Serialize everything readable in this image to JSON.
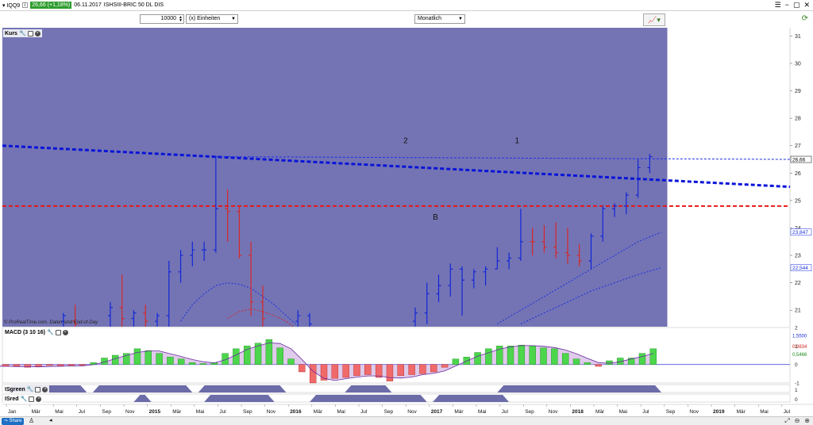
{
  "toolbar": {
    "symbol": "IQQ9",
    "info_icon": "i",
    "price_change": "26,66 (+1,18%)",
    "date": "06.11.2017",
    "instrument": "ISHSIII-BRIC 50 DL DIS",
    "quantity": "10000",
    "unit_select": "(x) Einheiten",
    "interval_select": "Monatlich",
    "window_icons": [
      "menu-icon",
      "minimize-icon",
      "restore-icon",
      "close-icon"
    ]
  },
  "panels": {
    "kurs": "Kurs",
    "macd": "MACD (3 10 16)",
    "isgreen": "ISgreen",
    "isred": "ISred"
  },
  "credit": "© ProRealTime.com. Daten sind End-of-Day",
  "share_label": "Share",
  "chart_data": {
    "type": "ohlc",
    "price_ylim": [
      20.4,
      31.3
    ],
    "price_ticks": [
      21,
      22,
      23,
      24,
      25,
      26,
      27,
      28,
      29,
      30,
      31
    ],
    "price_labels": {
      "last": "26,66",
      "upper_ma": "23,847",
      "lower_ma": "22,544"
    },
    "annotations": [
      {
        "text": "2",
        "month": 34,
        "price": 27.1
      },
      {
        "text": "1",
        "month": 43.5,
        "price": 27.1
      },
      {
        "text": "B",
        "month": 36.5,
        "price": 24.3
      }
    ],
    "candles": [
      {
        "m": 5,
        "o": 20.6,
        "h": 20.9,
        "l": 20.4,
        "c": 20.8,
        "dir": "up"
      },
      {
        "m": 6,
        "o": 20.6,
        "h": 21.2,
        "l": 20.4,
        "c": 20.5,
        "dir": "down"
      },
      {
        "m": 9,
        "o": 20.8,
        "h": 21.3,
        "l": 20.4,
        "c": 21.1,
        "dir": "up"
      },
      {
        "m": 10,
        "o": 21.1,
        "h": 22.3,
        "l": 20.4,
        "c": 20.7,
        "dir": "down"
      },
      {
        "m": 11,
        "o": 20.7,
        "h": 21.0,
        "l": 20.4,
        "c": 20.9,
        "dir": "up"
      },
      {
        "m": 12,
        "o": 20.9,
        "h": 21.2,
        "l": 20.4,
        "c": 20.6,
        "dir": "down"
      },
      {
        "m": 13,
        "o": 20.6,
        "h": 20.9,
        "l": 20.4,
        "c": 20.8,
        "dir": "up"
      },
      {
        "m": 14,
        "o": 20.8,
        "h": 22.8,
        "l": 20.4,
        "c": 22.4,
        "dir": "up"
      },
      {
        "m": 15,
        "o": 22.4,
        "h": 23.2,
        "l": 22.0,
        "c": 23.0,
        "dir": "up"
      },
      {
        "m": 16,
        "o": 23.0,
        "h": 23.5,
        "l": 22.6,
        "c": 23.2,
        "dir": "up"
      },
      {
        "m": 17,
        "o": 23.2,
        "h": 23.5,
        "l": 22.8,
        "c": 23.2,
        "dir": "up"
      },
      {
        "m": 18,
        "o": 23.2,
        "h": 26.6,
        "l": 23.1,
        "c": 24.7,
        "dir": "up"
      },
      {
        "m": 19,
        "o": 24.7,
        "h": 25.4,
        "l": 23.5,
        "c": 24.6,
        "dir": "down"
      },
      {
        "m": 20,
        "o": 24.6,
        "h": 24.8,
        "l": 22.9,
        "c": 23.0,
        "dir": "down"
      },
      {
        "m": 21,
        "o": 23.0,
        "h": 23.5,
        "l": 20.8,
        "c": 21.3,
        "dir": "down"
      },
      {
        "m": 22,
        "o": 21.3,
        "h": 21.9,
        "l": 20.4,
        "c": 20.7,
        "dir": "down"
      },
      {
        "m": 25,
        "o": 20.6,
        "h": 21.0,
        "l": 20.4,
        "c": 20.8,
        "dir": "up"
      },
      {
        "m": 26,
        "o": 20.8,
        "h": 20.9,
        "l": 20.4,
        "c": 20.5,
        "dir": "up"
      },
      {
        "m": 35,
        "o": 20.6,
        "h": 21.1,
        "l": 20.4,
        "c": 20.9,
        "dir": "up"
      },
      {
        "m": 36,
        "o": 20.9,
        "h": 22.0,
        "l": 20.5,
        "c": 21.6,
        "dir": "up"
      },
      {
        "m": 37,
        "o": 21.6,
        "h": 22.3,
        "l": 21.3,
        "c": 21.9,
        "dir": "up"
      },
      {
        "m": 38,
        "o": 21.9,
        "h": 22.7,
        "l": 21.5,
        "c": 22.5,
        "dir": "up"
      },
      {
        "m": 39,
        "o": 22.5,
        "h": 22.6,
        "l": 20.8,
        "c": 22.1,
        "dir": "up"
      },
      {
        "m": 40,
        "o": 22.1,
        "h": 22.5,
        "l": 21.8,
        "c": 22.4,
        "dir": "up"
      },
      {
        "m": 41,
        "o": 22.4,
        "h": 22.6,
        "l": 21.9,
        "c": 22.5,
        "dir": "up"
      },
      {
        "m": 42,
        "o": 22.5,
        "h": 23.3,
        "l": 22.5,
        "c": 22.8,
        "dir": "up"
      },
      {
        "m": 43,
        "o": 22.8,
        "h": 23.1,
        "l": 22.5,
        "c": 22.9,
        "dir": "up"
      },
      {
        "m": 44,
        "o": 22.9,
        "h": 24.7,
        "l": 22.8,
        "c": 23.5,
        "dir": "up"
      },
      {
        "m": 45,
        "o": 23.5,
        "h": 24.0,
        "l": 23.0,
        "c": 23.5,
        "dir": "down"
      },
      {
        "m": 46,
        "o": 23.5,
        "h": 24.1,
        "l": 23.1,
        "c": 23.3,
        "dir": "down"
      },
      {
        "m": 47,
        "o": 23.3,
        "h": 24.2,
        "l": 22.9,
        "c": 23.1,
        "dir": "down"
      },
      {
        "m": 48,
        "o": 23.1,
        "h": 24.0,
        "l": 22.7,
        "c": 23.0,
        "dir": "down"
      },
      {
        "m": 49,
        "o": 23.0,
        "h": 23.4,
        "l": 22.6,
        "c": 22.8,
        "dir": "down"
      },
      {
        "m": 50,
        "o": 22.8,
        "h": 23.8,
        "l": 22.5,
        "c": 23.7,
        "dir": "up"
      },
      {
        "m": 51,
        "o": 23.7,
        "h": 24.8,
        "l": 23.5,
        "c": 24.7,
        "dir": "up"
      },
      {
        "m": 52,
        "o": 24.7,
        "h": 24.9,
        "l": 24.4,
        "c": 24.8,
        "dir": "up"
      },
      {
        "m": 53,
        "o": 24.8,
        "h": 25.3,
        "l": 24.5,
        "c": 25.2,
        "dir": "up"
      },
      {
        "m": 54,
        "o": 25.2,
        "h": 26.5,
        "l": 25.1,
        "c": 26.2,
        "dir": "up"
      },
      {
        "m": 55,
        "o": 26.2,
        "h": 26.7,
        "l": 26.0,
        "c": 26.6,
        "dir": "up"
      }
    ],
    "macd_ylim": [
      -1,
      2
    ],
    "macd_ticks": [
      "2",
      "1",
      "0",
      "-1"
    ],
    "macd_labels": [
      "1,5500",
      "0,9834",
      "0,5466"
    ],
    "macd_hist": [
      -0.1,
      -0.1,
      -0.12,
      -0.15,
      -0.12,
      -0.05,
      -0.1,
      -0.08,
      -0.05,
      0.1,
      0.35,
      0.5,
      0.6,
      0.85,
      0.75,
      0.6,
      0.4,
      0.3,
      0.1,
      0.05,
      0.1,
      0.6,
      0.85,
      1.0,
      1.15,
      1.35,
      0.9,
      0.3,
      -0.4,
      -1.0,
      -0.85,
      -0.75,
      -0.7,
      -0.6,
      -0.55,
      -0.7,
      -0.9,
      -0.6,
      -0.55,
      -0.5,
      -0.4,
      -0.15,
      0.3,
      0.4,
      0.65,
      0.85,
      1.0,
      1.0,
      1.05,
      1.0,
      0.9,
      0.85,
      0.6,
      0.3,
      0.1,
      -0.1,
      0.2,
      0.35,
      0.35,
      0.6,
      0.85
    ],
    "macd_scale_labels": {
      "isgreen": "1",
      "isred": "0"
    },
    "x_labels": [
      "Jan",
      "Mär",
      "Mai",
      "Jul",
      "Sep",
      "Nov",
      "2015",
      "Mär",
      "Mai",
      "Jul",
      "Sep",
      "Nov",
      "2016",
      "Mär",
      "Mai",
      "Jul",
      "Sep",
      "Nov",
      "2017",
      "Mär",
      "Mai",
      "Jul",
      "Sep",
      "Nov",
      "2018",
      "Mär",
      "Mai",
      "Jul",
      "Sep",
      "Nov",
      "2019",
      "Mär",
      "Mai",
      "Jul"
    ]
  }
}
